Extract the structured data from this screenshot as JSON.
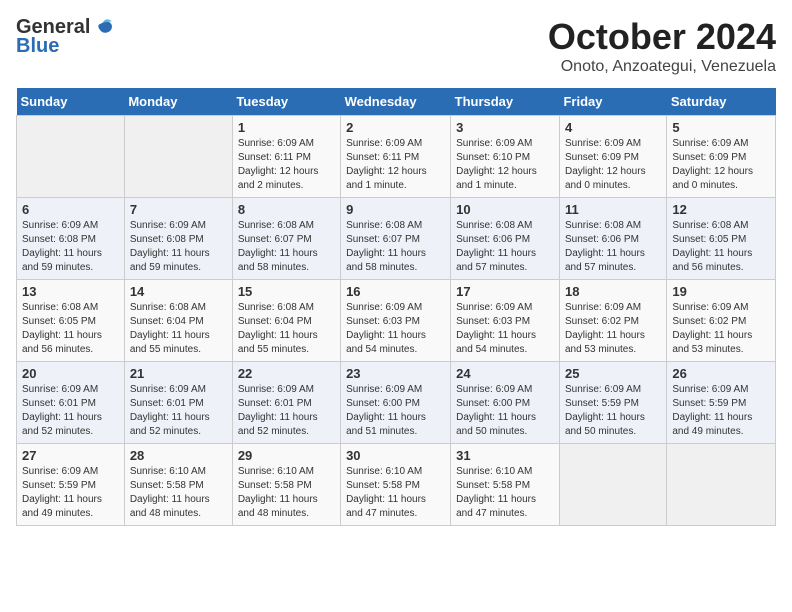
{
  "logo": {
    "general": "General",
    "blue": "Blue"
  },
  "title": "October 2024",
  "subtitle": "Onoto, Anzoategui, Venezuela",
  "weekdays": [
    "Sunday",
    "Monday",
    "Tuesday",
    "Wednesday",
    "Thursday",
    "Friday",
    "Saturday"
  ],
  "weeks": [
    [
      {
        "day": "",
        "info": ""
      },
      {
        "day": "",
        "info": ""
      },
      {
        "day": "1",
        "info": "Sunrise: 6:09 AM\nSunset: 6:11 PM\nDaylight: 12 hours\nand 2 minutes."
      },
      {
        "day": "2",
        "info": "Sunrise: 6:09 AM\nSunset: 6:11 PM\nDaylight: 12 hours\nand 1 minute."
      },
      {
        "day": "3",
        "info": "Sunrise: 6:09 AM\nSunset: 6:10 PM\nDaylight: 12 hours\nand 1 minute."
      },
      {
        "day": "4",
        "info": "Sunrise: 6:09 AM\nSunset: 6:09 PM\nDaylight: 12 hours\nand 0 minutes."
      },
      {
        "day": "5",
        "info": "Sunrise: 6:09 AM\nSunset: 6:09 PM\nDaylight: 12 hours\nand 0 minutes."
      }
    ],
    [
      {
        "day": "6",
        "info": "Sunrise: 6:09 AM\nSunset: 6:08 PM\nDaylight: 11 hours\nand 59 minutes."
      },
      {
        "day": "7",
        "info": "Sunrise: 6:09 AM\nSunset: 6:08 PM\nDaylight: 11 hours\nand 59 minutes."
      },
      {
        "day": "8",
        "info": "Sunrise: 6:08 AM\nSunset: 6:07 PM\nDaylight: 11 hours\nand 58 minutes."
      },
      {
        "day": "9",
        "info": "Sunrise: 6:08 AM\nSunset: 6:07 PM\nDaylight: 11 hours\nand 58 minutes."
      },
      {
        "day": "10",
        "info": "Sunrise: 6:08 AM\nSunset: 6:06 PM\nDaylight: 11 hours\nand 57 minutes."
      },
      {
        "day": "11",
        "info": "Sunrise: 6:08 AM\nSunset: 6:06 PM\nDaylight: 11 hours\nand 57 minutes."
      },
      {
        "day": "12",
        "info": "Sunrise: 6:08 AM\nSunset: 6:05 PM\nDaylight: 11 hours\nand 56 minutes."
      }
    ],
    [
      {
        "day": "13",
        "info": "Sunrise: 6:08 AM\nSunset: 6:05 PM\nDaylight: 11 hours\nand 56 minutes."
      },
      {
        "day": "14",
        "info": "Sunrise: 6:08 AM\nSunset: 6:04 PM\nDaylight: 11 hours\nand 55 minutes."
      },
      {
        "day": "15",
        "info": "Sunrise: 6:08 AM\nSunset: 6:04 PM\nDaylight: 11 hours\nand 55 minutes."
      },
      {
        "day": "16",
        "info": "Sunrise: 6:09 AM\nSunset: 6:03 PM\nDaylight: 11 hours\nand 54 minutes."
      },
      {
        "day": "17",
        "info": "Sunrise: 6:09 AM\nSunset: 6:03 PM\nDaylight: 11 hours\nand 54 minutes."
      },
      {
        "day": "18",
        "info": "Sunrise: 6:09 AM\nSunset: 6:02 PM\nDaylight: 11 hours\nand 53 minutes."
      },
      {
        "day": "19",
        "info": "Sunrise: 6:09 AM\nSunset: 6:02 PM\nDaylight: 11 hours\nand 53 minutes."
      }
    ],
    [
      {
        "day": "20",
        "info": "Sunrise: 6:09 AM\nSunset: 6:01 PM\nDaylight: 11 hours\nand 52 minutes."
      },
      {
        "day": "21",
        "info": "Sunrise: 6:09 AM\nSunset: 6:01 PM\nDaylight: 11 hours\nand 52 minutes."
      },
      {
        "day": "22",
        "info": "Sunrise: 6:09 AM\nSunset: 6:01 PM\nDaylight: 11 hours\nand 52 minutes."
      },
      {
        "day": "23",
        "info": "Sunrise: 6:09 AM\nSunset: 6:00 PM\nDaylight: 11 hours\nand 51 minutes."
      },
      {
        "day": "24",
        "info": "Sunrise: 6:09 AM\nSunset: 6:00 PM\nDaylight: 11 hours\nand 50 minutes."
      },
      {
        "day": "25",
        "info": "Sunrise: 6:09 AM\nSunset: 5:59 PM\nDaylight: 11 hours\nand 50 minutes."
      },
      {
        "day": "26",
        "info": "Sunrise: 6:09 AM\nSunset: 5:59 PM\nDaylight: 11 hours\nand 49 minutes."
      }
    ],
    [
      {
        "day": "27",
        "info": "Sunrise: 6:09 AM\nSunset: 5:59 PM\nDaylight: 11 hours\nand 49 minutes."
      },
      {
        "day": "28",
        "info": "Sunrise: 6:10 AM\nSunset: 5:58 PM\nDaylight: 11 hours\nand 48 minutes."
      },
      {
        "day": "29",
        "info": "Sunrise: 6:10 AM\nSunset: 5:58 PM\nDaylight: 11 hours\nand 48 minutes."
      },
      {
        "day": "30",
        "info": "Sunrise: 6:10 AM\nSunset: 5:58 PM\nDaylight: 11 hours\nand 47 minutes."
      },
      {
        "day": "31",
        "info": "Sunrise: 6:10 AM\nSunset: 5:58 PM\nDaylight: 11 hours\nand 47 minutes."
      },
      {
        "day": "",
        "info": ""
      },
      {
        "day": "",
        "info": ""
      }
    ]
  ]
}
